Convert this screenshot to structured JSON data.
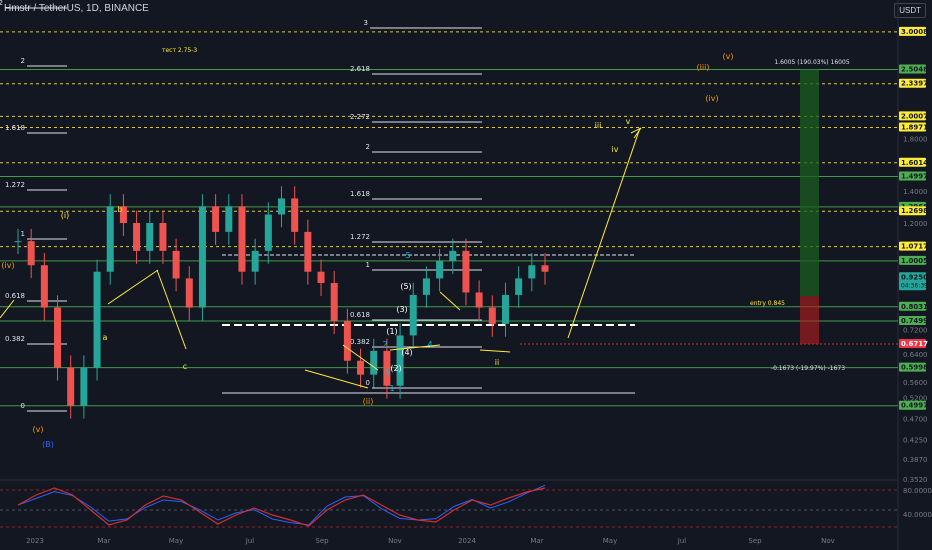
{
  "header": {
    "title": "Hmstr / TetherUS, 1D, BINANCE",
    "currency": "USDT"
  },
  "colors": {
    "bg": "#131722",
    "up": "#26a69a",
    "down": "#ef5350",
    "green": "#4caf50",
    "fib": "#e0e3eb",
    "wave": "#f0b90b",
    "orange": "#ff9800",
    "label_yellow": "#ffeb3b",
    "label_green": "#4caf50",
    "label_red": "#f23645",
    "rsi": "#d32f2f",
    "ema": "#2962ff"
  },
  "chart_data": {
    "type": "candlestick",
    "title": "Hmstr / TetherUS, 1D, BINANCE",
    "ylabel": "USDT",
    "x_ticks": [
      "2023",
      "Mar",
      "May",
      "Jul",
      "Sep",
      "Nov",
      "2024",
      "Mar",
      "May",
      "Jul",
      "Sep",
      "Nov"
    ],
    "y_axis_ticks": [
      "1.8000",
      "1.6000",
      "1.4000",
      "1.2000",
      "1.0000",
      "0.8000",
      "0.7200",
      "0.6400",
      "0.5600",
      "0.5200",
      "0.4700",
      "0.4250",
      "0.3870",
      "0.3520"
    ],
    "price_labels": [
      {
        "text": "3.0008",
        "kind": "yellow"
      },
      {
        "text": "2.5048",
        "kind": "green"
      },
      {
        "text": "2.3397",
        "kind": "yellow"
      },
      {
        "text": "2.0007",
        "kind": "yellow"
      },
      {
        "text": "1.8971",
        "kind": "yellow"
      },
      {
        "text": "1.6014",
        "kind": "yellow"
      },
      {
        "text": "1.4997",
        "kind": "green"
      },
      {
        "text": "1.2968",
        "kind": "green"
      },
      {
        "text": "1.2698",
        "kind": "yellow"
      },
      {
        "text": "1.0717",
        "kind": "yellow"
      },
      {
        "text": "1.0005",
        "kind": "green"
      },
      {
        "text": "0.9250",
        "kind": "current",
        "sub": "04:36:39"
      },
      {
        "text": "0.8031",
        "kind": "green"
      },
      {
        "text": "0.7499",
        "kind": "green"
      },
      {
        "text": "0.6717",
        "kind": "red"
      },
      {
        "text": "0.5998",
        "kind": "green"
      },
      {
        "text": "0.4997",
        "kind": "green"
      }
    ],
    "fib_labels": [
      "3",
      "2",
      "2.618",
      "2.272",
      "1.618",
      "2",
      "1.272",
      "1.618",
      "1",
      "1.272",
      "0.618",
      "1",
      "0.382",
      "0.618",
      "0",
      "0.382",
      "0",
      "2.272"
    ],
    "wave_labels": [
      "(i)",
      "b",
      "(iv)",
      "a",
      "c",
      "(v)",
      "(B)",
      "(ii)",
      "iii",
      "v",
      "iv",
      "(iii)",
      "(v)",
      "(iv)",
      "ii",
      "(1)",
      "(2)",
      "(3)",
      "(4)",
      "(5)",
      "1",
      "2",
      "3",
      "4",
      "5"
    ],
    "annotations": [
      "тест 2.75-3",
      "1.6005 (190.03%) 16005",
      "entry 0.845",
      "-0.1673 (-19.97%) -1673"
    ],
    "rsi_ticks": [
      "80.0000",
      "40.0000"
    ],
    "series": [
      {
        "name": "Price",
        "type": "candlestick",
        "close": [
          1.1,
          0.98,
          0.8,
          0.6,
          0.5,
          0.6,
          0.95,
          1.3,
          1.2,
          1.05,
          1.2,
          1.05,
          0.92,
          0.8,
          1.3,
          1.15,
          1.3,
          0.95,
          1.05,
          1.25,
          1.35,
          1.15,
          0.95,
          0.9,
          0.75,
          0.62,
          0.58,
          0.65,
          0.55,
          0.7,
          0.85,
          0.92,
          1.0,
          1.05,
          0.86,
          0.8,
          0.74,
          0.85,
          0.92,
          0.98,
          0.95
        ]
      }
    ]
  }
}
